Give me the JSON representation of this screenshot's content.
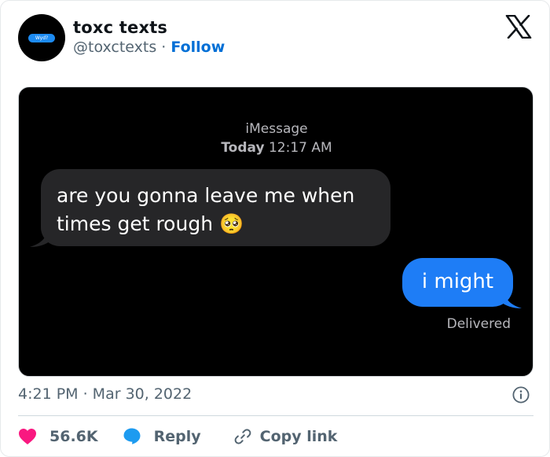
{
  "author": {
    "name": "toxc texts",
    "handle": "@toxctexts",
    "separator": "·",
    "follow_label": "Follow",
    "avatar_text": "Wyd?"
  },
  "media": {
    "service": "iMessage",
    "day": "Today",
    "time": "12:17 AM",
    "incoming_text": "are you gonna leave me when times get rough 🥺",
    "outgoing_text": "i might",
    "delivered": "Delivered"
  },
  "footer": {
    "timestamp": "4:21 PM · Mar 30, 2022",
    "likes": "56.6K",
    "reply_label": "Reply",
    "copy_label": "Copy link"
  },
  "colors": {
    "like": "#f91880",
    "reply": "#1d9bf0",
    "follow": "#006fd6",
    "imessage_blue": "#1e7df6",
    "incoming_bubble": "#262628"
  },
  "icons": [
    "x-logo-icon",
    "info-icon",
    "heart-icon",
    "reply-bubble-icon",
    "link-icon"
  ]
}
